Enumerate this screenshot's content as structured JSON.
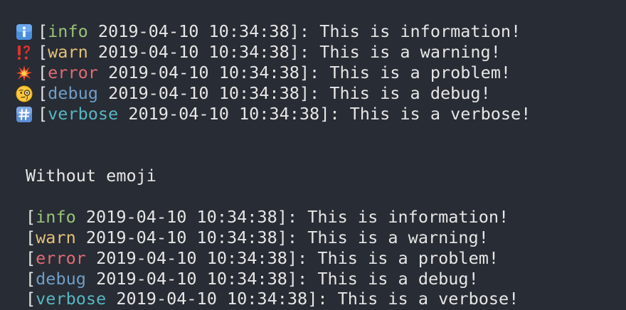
{
  "timestamp": "2019-04-10 10:34:38",
  "colors": {
    "background": "#282c34",
    "text": "#e6e6e6",
    "info": "#98c379",
    "warn": "#e5c07b",
    "error": "#e06c75",
    "debug": "#6f9ec7",
    "verbose": "#56b6c2"
  },
  "with_emoji": [
    {
      "icon": "info-emoji-icon",
      "level": "info",
      "message": "This is information!"
    },
    {
      "icon": "exclamation-question-emoji-icon",
      "level": "warn",
      "message": "This is a warning!"
    },
    {
      "icon": "collision-emoji-icon",
      "level": "error",
      "message": "This is a problem!"
    },
    {
      "icon": "monocle-face-emoji-icon",
      "level": "debug",
      "message": "This is a debug!"
    },
    {
      "icon": "hash-keycap-emoji-icon",
      "level": "verbose",
      "message": "This is a verbose!"
    }
  ],
  "section_heading": "Without emoji",
  "without_emoji": [
    {
      "level": "info",
      "message": "This is information!"
    },
    {
      "level": "warn",
      "message": "This is a warning!"
    },
    {
      "level": "error",
      "message": "This is a problem!"
    },
    {
      "level": "debug",
      "message": "This is a debug!"
    },
    {
      "level": "verbose",
      "message": "This is a verbose!"
    }
  ]
}
